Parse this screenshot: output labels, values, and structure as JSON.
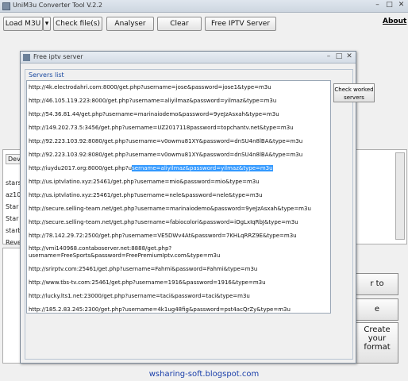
{
  "app": {
    "title": "UniM3u Converter Tool V.2.2"
  },
  "toolbar": {
    "load_m3u": "Load M3U",
    "dropdown_arrow": "▾",
    "check_files": "Check file(s)",
    "analyser": "Analyser",
    "clear": "Clear",
    "free_iptv_server": "Free IPTV Server",
    "about": "About"
  },
  "background": {
    "dev_label": "Dev",
    "side_items": [
      "stars",
      "az10",
      "Star",
      "Star",
      "starb",
      "Reve"
    ],
    "right_buttons": [
      "r to",
      "e",
      "Create\nyour\nformat"
    ]
  },
  "dialog": {
    "title": "Free iptv server",
    "group_label": "Servers list",
    "check_button": "Check worked servers",
    "servers": [
      "http://4k.electrodahri.com:8000/get.php?username=jose&password=jose1&type=m3u",
      "http://46.105.119.223:8000/get.php?username=aliyilmaz&password=yilmaz&type=m3u",
      "http://54.36.81.44/get.php?username=marinaiodemo&password=9yeJzAsxah&type=m3u",
      "http://149.202.73.5:3456/get.php?username=UZ2017118password=topchantv.net&type=m3u",
      "http://92.223.103.92:8080/get.php?username=v0owmu81XY&password=dnSU4n8lBA&type=m3u",
      "http://92.223.103.92:8080/get.php?username=v0owmu81XY&password=dnSU4n8lBA&type=m3u",
      "http://iuydu2017.org:8000/get.php?username=aliyilmaz&password=yilmaz&type=m3u",
      "http://us.iptvlatino.xyz:25461/get.php?username=mio&password=mio&type=m3u",
      "http://us.iptvlatino.xyz:25461/get.php?username=nele&password=nele&type=m3u",
      "http://secure.selling-team.net/get.php?username=marinaiodemo&password=9yeJzAsxah&type=m3u",
      "http://secure.selling-team.net/get.php?username=fabiocolori&password=iOgLxIqRbJ&type=m3u",
      "http://78.142.29.72:2500/get.php?username=VE5DWv4At&password=7KHLqRRZ9E&type=m3u",
      "http://vmi140968.contaboserver.net:8888/get.php?\nusername=FreeSports&password=FreePremiumIptv.com&type=m3u",
      "http://srirptv.com:25461/get.php?username=Fahmi&password=Fahmi&type=m3u",
      "http://www.tbs-tv.com:25461/get.php?username=1916&password=1916&type=m3u",
      "http://lucky.lts1.net:23000/get.php?username=taci&password=taci&type=m3u",
      "http://185.2.83.245:2300/get.php?username=4k1ug48fig&password=pst4acQrZy&type=m3u"
    ],
    "selected_prefix": "http://iuydu2017.org:8000/get.php?u",
    "selected_text": "sername=aliyilmaz&password=yilmaz&type=m3u"
  },
  "footer": {
    "watermark": "wsharing-soft.blogspot.com"
  }
}
